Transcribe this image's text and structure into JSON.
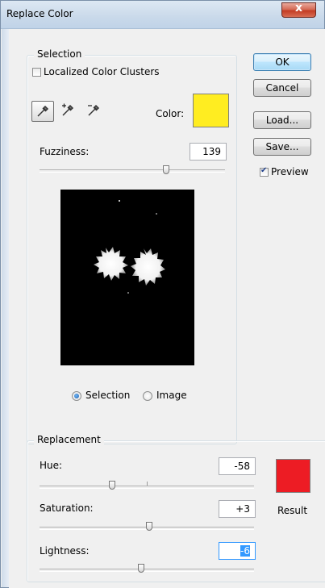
{
  "window": {
    "title": "Replace Color",
    "close_label": "x"
  },
  "selection": {
    "legend": "Selection",
    "localized_clusters_label": "Localized Color Clusters",
    "localized_clusters_checked": false,
    "tools": [
      "eyedropper-icon",
      "eyedropper-plus-icon",
      "eyedropper-minus-icon"
    ],
    "color_label": "Color:",
    "color_value": "#ffed21",
    "fuzziness_label": "Fuzziness:",
    "fuzziness_value": "139",
    "fuzziness_level": 0.69,
    "view_options": [
      {
        "label": "Selection",
        "checked": true
      },
      {
        "label": "Image",
        "checked": false
      }
    ]
  },
  "replacement": {
    "legend": "Replacement",
    "hue_label": "Hue:",
    "hue_value": "-58",
    "saturation_label": "Saturation:",
    "saturation_value": "+3",
    "lightness_label": "Lightness:",
    "lightness_value": "-6",
    "result_label": "Result",
    "result_color": "#ed1c24"
  },
  "buttons": {
    "ok": "OK",
    "cancel": "Cancel",
    "load": "Load...",
    "save": "Save..."
  },
  "preview": {
    "label": "Preview",
    "checked": true
  }
}
